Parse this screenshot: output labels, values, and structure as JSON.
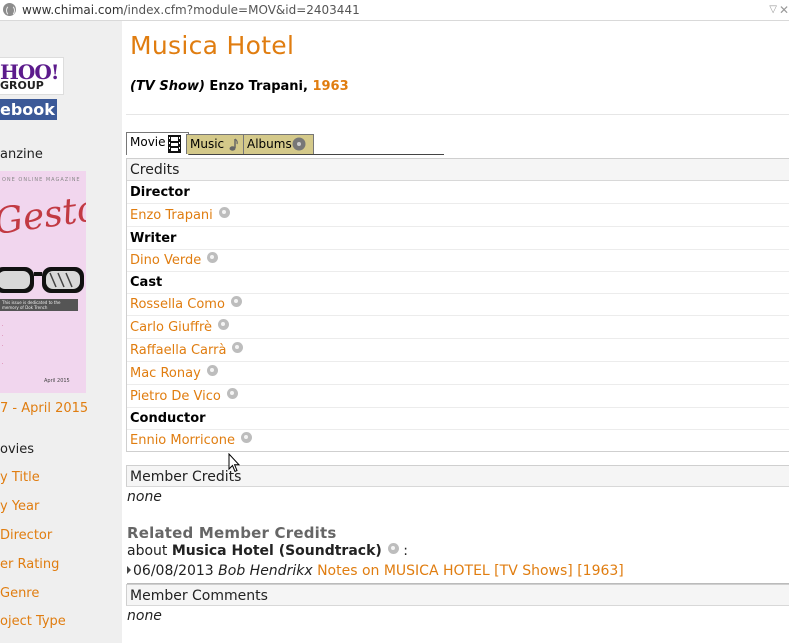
{
  "browser": {
    "url_host": "www.chimai.com",
    "url_path": "/index.cfm?module=MOV&id=2403441"
  },
  "sidebar": {
    "yahoo_text": "HOO!",
    "yahoo_sub": "GROUP",
    "facebook_text": "ebook",
    "magazine_label": "anzine",
    "magazine_cover_head": "ONE   ONLINE MAGAZINE",
    "magazine_cover_script": "Gesto",
    "magazine_cover_dedication": "This issue is dedicated to the memory of Dok Trench",
    "magazine_cover_date": "April 2015",
    "magazine_issue_link": "7 - April 2015",
    "movies_heading": "ovies",
    "links": [
      "y Title",
      "y Year",
      "Director",
      "er Rating",
      "Genre",
      "oject Type"
    ]
  },
  "movie": {
    "title": "Musica Hotel",
    "type": "(TV Show)",
    "director_line": " Enzo Trapani, ",
    "year": "1963"
  },
  "tabs": [
    {
      "label": "Movie",
      "icon": "film-icon",
      "active": true
    },
    {
      "label": "Music",
      "icon": "music-note-icon",
      "active": false
    },
    {
      "label": "Albums",
      "icon": "disc-icon",
      "active": false
    }
  ],
  "credits": {
    "heading": "Credits",
    "rows": [
      {
        "kind": "role",
        "text": "Director"
      },
      {
        "kind": "name",
        "text": "Enzo Trapani"
      },
      {
        "kind": "role",
        "text": "Writer"
      },
      {
        "kind": "name",
        "text": "Dino Verde"
      },
      {
        "kind": "role",
        "text": "Cast"
      },
      {
        "kind": "name",
        "text": "Rossella Como"
      },
      {
        "kind": "name",
        "text": "Carlo Giuffrè"
      },
      {
        "kind": "name",
        "text": "Raffaella Carrà"
      },
      {
        "kind": "name",
        "text": "Mac Ronay"
      },
      {
        "kind": "name",
        "text": "Pietro De Vico"
      },
      {
        "kind": "role",
        "text": "Conductor"
      },
      {
        "kind": "name",
        "text": "Ennio Morricone"
      }
    ]
  },
  "member_credits": {
    "heading": "Member Credits",
    "value": "none"
  },
  "related": {
    "heading": "Related Member Credits",
    "about_prefix": "about ",
    "about_title": "Musica Hotel (Soundtrack)",
    "about_suffix": " :",
    "note_date": "06/08/2013 ",
    "note_author": "Bob Hendrikx",
    "note_link": "Notes on MUSICA HOTEL [TV Shows] [1963]"
  },
  "member_comments": {
    "heading": "Member Comments",
    "value": "none"
  },
  "colors": {
    "accent": "#e07d10",
    "tab_inactive": "#d4c98a",
    "sidebar_bg": "#efefef",
    "facebook_blue": "#3b5998"
  }
}
